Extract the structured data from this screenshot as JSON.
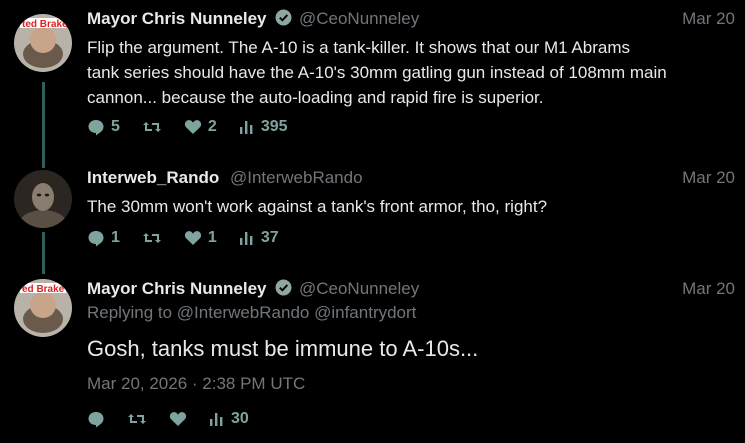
{
  "colors": {
    "background": "#000000",
    "text": "#e7e9ea",
    "muted": "#71767b",
    "action": "#7fa39f",
    "thread_line": "#2f5e5c",
    "verified": "#8fa6a3"
  },
  "tweets": [
    {
      "name": "Mayor Chris Nunneley",
      "verified": true,
      "handle": "@CeoNunneley",
      "date": "Mar 20",
      "text_lines": [
        "Flip the argument.  The A-10 is a tank-killer.  It shows that our M1 Abrams",
        "tank series should have the A-10's 30mm gatling gun instead of 108mm main",
        "cannon... because the auto-loading and rapid fire is superior."
      ],
      "replies": "5",
      "retweets": "",
      "likes": "2",
      "views": "395",
      "avatar_text": "ted Brake"
    },
    {
      "name": "Interweb_Rando",
      "verified": false,
      "handle": "@InterwebRando",
      "date": "Mar 20",
      "text": "The 30mm won't work against a tank's front armor, tho, right?",
      "replies": "1",
      "retweets": "",
      "likes": "1",
      "views": "37"
    },
    {
      "name": "Mayor Chris Nunneley",
      "verified": true,
      "handle": "@CeoNunneley",
      "date": "Mar 20",
      "replying_prefix": "Replying to",
      "replying_to": [
        "@InterwebRando",
        "@infantrydort"
      ],
      "text": "Gosh, tanks must be immune to A-10s...",
      "timestamp": "Mar 20, 2026 · 2:38 PM UTC",
      "views": "30",
      "avatar_text": "ed Brake"
    }
  ],
  "icons": [
    "reply-icon",
    "retweet-icon",
    "like-icon",
    "views-icon",
    "verified-icon"
  ]
}
